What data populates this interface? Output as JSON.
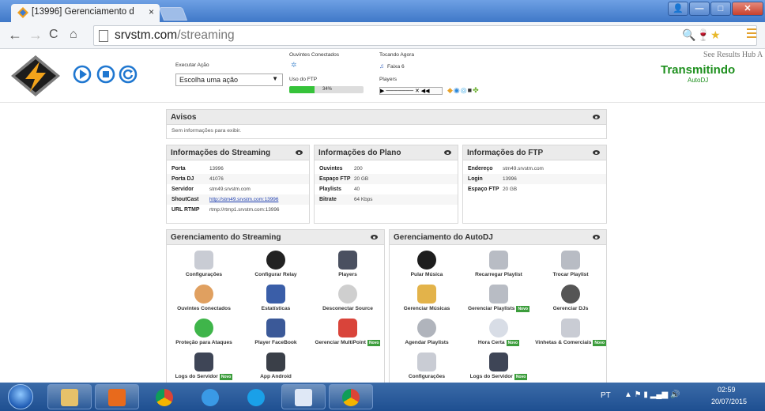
{
  "browser": {
    "tab_title": "[13996] Gerenciamento d",
    "tab_close": "×",
    "url_host": "srvstm.com",
    "url_path": "/streaming",
    "window_controls": {
      "min": "—",
      "max": "□",
      "close": "✕"
    }
  },
  "header": {
    "acao_label": "Executar Ação",
    "acao_select": "Escolha uma ação",
    "ouvintes_label": "Ouvintes Conectados",
    "ftp_label": "Uso do FTP",
    "ftp_percent_text": "34%",
    "ftp_fraction": 0.34,
    "tocando_label": "Tocando Agora",
    "tocando_value": "Faixa 6",
    "players_label": "Players",
    "status": "Transmitindo",
    "status_sub": "AutoDJ",
    "see_results": "See Results Hub A"
  },
  "avisos": {
    "title": "Avisos",
    "text": "Sem informações para exibir."
  },
  "streaming_info": {
    "title": "Informações do Streaming",
    "rows": [
      {
        "k": "Porta",
        "v": "13996"
      },
      {
        "k": "Porta DJ",
        "v": "41076"
      },
      {
        "k": "Servidor",
        "v": "stm49.srvstm.com"
      },
      {
        "k": "ShoutCast",
        "v": "http://stm49.srvstm.com:13996"
      },
      {
        "k": "URL RTMP",
        "v": "rtmp://rtmp1.srvstm.com:13996"
      }
    ]
  },
  "plano_info": {
    "title": "Informações do Plano",
    "rows": [
      {
        "k": "Ouvintes",
        "v": "200"
      },
      {
        "k": "Espaço FTP",
        "v": "20 GB"
      },
      {
        "k": "Playlists",
        "v": "40"
      },
      {
        "k": "Bitrate",
        "v": "64 Kbps"
      }
    ]
  },
  "ftp_info": {
    "title": "Informações do FTP",
    "rows": [
      {
        "k": "Endereço",
        "v": "stm49.srvstm.com"
      },
      {
        "k": "Login",
        "v": "13996"
      },
      {
        "k": "Espaço FTP",
        "v": "20 GB"
      }
    ]
  },
  "gerenciamento_streaming": {
    "title": "Gerenciamento do Streaming",
    "items": [
      {
        "label": "Configurações",
        "icon": "settings-icon",
        "novo": false
      },
      {
        "label": "Configurar Relay",
        "icon": "play-circle-icon",
        "novo": false
      },
      {
        "label": "Players",
        "icon": "player-icon",
        "novo": false
      },
      {
        "label": "Ouvintes Conectados",
        "icon": "users-icon",
        "novo": false
      },
      {
        "label": "Estatísticas",
        "icon": "stats-icon",
        "novo": false
      },
      {
        "label": "Desconectar Source",
        "icon": "disconnect-icon",
        "novo": false
      },
      {
        "label": "Proteção para Ataques",
        "icon": "shield-icon",
        "novo": false
      },
      {
        "label": "Player FaceBook",
        "icon": "facebook-icon",
        "novo": false
      },
      {
        "label": "Gerenciar MultiPoint",
        "icon": "network-icon",
        "novo": true
      },
      {
        "label": "Logs do Servidor",
        "icon": "server-log-icon",
        "novo": true
      },
      {
        "label": "App Android",
        "icon": "android-icon",
        "novo": false
      }
    ]
  },
  "gerenciamento_autodj": {
    "title": "Gerenciamento do AutoDJ",
    "items": [
      {
        "label": "Pular Música",
        "icon": "skip-icon",
        "novo": false
      },
      {
        "label": "Recarregar Playlist",
        "icon": "reload-icon",
        "novo": false
      },
      {
        "label": "Trocar Playlist",
        "icon": "swap-icon",
        "novo": false
      },
      {
        "label": "Gerenciar Músicas",
        "icon": "folder-music-icon",
        "novo": false
      },
      {
        "label": "Gerenciar Playlists",
        "icon": "playlist-icon",
        "novo": true
      },
      {
        "label": "Gerenciar DJs",
        "icon": "dj-icon",
        "novo": false
      },
      {
        "label": "Agendar Playlists",
        "icon": "schedule-icon",
        "novo": false
      },
      {
        "label": "Hora Certa",
        "icon": "clock-icon",
        "novo": true
      },
      {
        "label": "Vinhetas & Comerciais",
        "icon": "clip-icon",
        "novo": true
      },
      {
        "label": "Configurações",
        "icon": "settings-icon",
        "novo": false
      },
      {
        "label": "Logs do Servidor",
        "icon": "server-log-icon",
        "novo": true
      }
    ]
  },
  "novo_label": "Novo",
  "taskbar": {
    "lang": "PT",
    "time": "02:59",
    "date": "20/07/2015"
  }
}
